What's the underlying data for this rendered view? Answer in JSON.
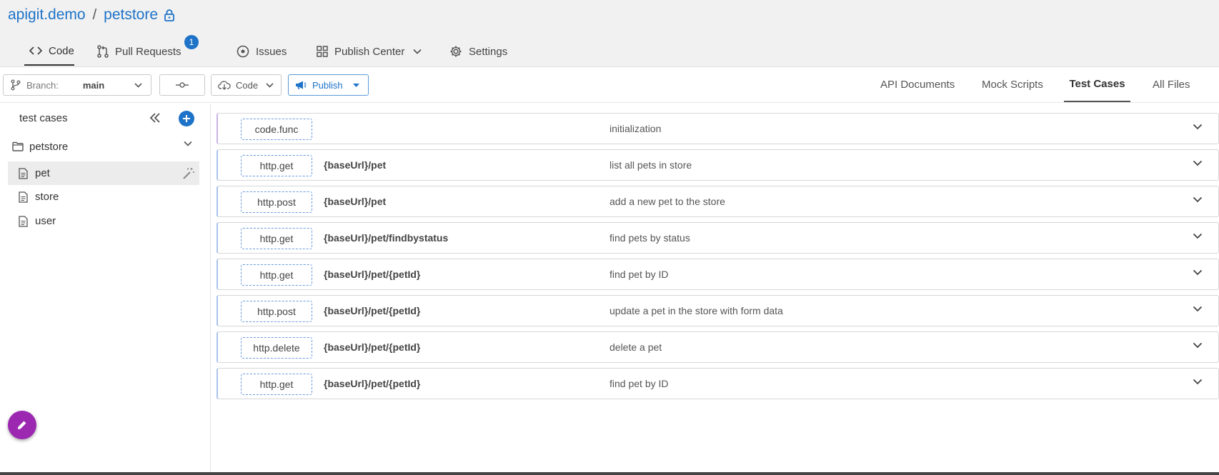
{
  "header": {
    "org": "apigit.demo",
    "separator": "/",
    "repo": "petstore",
    "lock_icon": "lock-icon"
  },
  "main_tabs": [
    {
      "label": "Code",
      "icon": "code-icon",
      "active": true
    },
    {
      "label": "Pull Requests",
      "icon": "pull-request-icon",
      "badge": "1"
    },
    {
      "label": "Issues",
      "icon": "issue-icon"
    },
    {
      "label": "Publish Center",
      "icon": "grid-icon",
      "dropdown": true
    },
    {
      "label": "Settings",
      "icon": "gear-icon"
    }
  ],
  "toolbar": {
    "branch_label": "Branch:",
    "branch_value": "main",
    "code_label": "Code",
    "publish_label": "Publish"
  },
  "right_tabs": [
    {
      "label": "API Documents"
    },
    {
      "label": "Mock Scripts"
    },
    {
      "label": "Test Cases",
      "active": true
    },
    {
      "label": "All Files"
    }
  ],
  "sidebar": {
    "title": "test cases",
    "folder": "petstore",
    "files": [
      {
        "label": "pet",
        "selected": true
      },
      {
        "label": "store"
      },
      {
        "label": "user"
      }
    ]
  },
  "test_cases": [
    {
      "type": "code.func",
      "path": "",
      "desc": "initialization"
    },
    {
      "type": "http.get",
      "path": "{baseUrl}/pet",
      "desc": "list all pets in store"
    },
    {
      "type": "http.post",
      "path": "{baseUrl}/pet",
      "desc": "add a new pet to the store"
    },
    {
      "type": "http.get",
      "path": "{baseUrl}/pet/findbystatus",
      "desc": "find pets by status"
    },
    {
      "type": "http.get",
      "path": "{baseUrl}/pet/{petId}",
      "desc": "find pet by ID"
    },
    {
      "type": "http.post",
      "path": "{baseUrl}/pet/{petId}",
      "desc": "update a pet in the store with form data"
    },
    {
      "type": "http.delete",
      "path": "{baseUrl}/pet/{petId}",
      "desc": "delete a pet"
    },
    {
      "type": "http.get",
      "path": "{baseUrl}/pet/{petId}",
      "desc": "find pet by ID"
    }
  ],
  "colors": {
    "accent": "#1e73c8",
    "fab": "#9c27b0"
  }
}
